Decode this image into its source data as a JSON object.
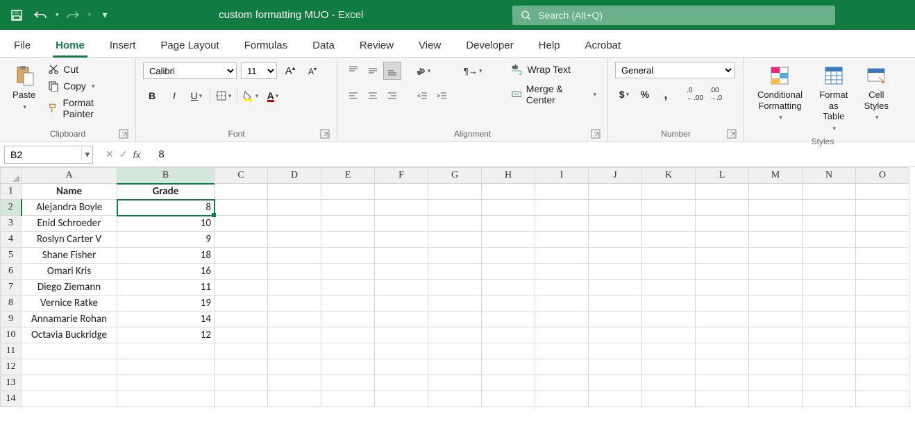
{
  "title": {
    "doc": "custom formatting MUO",
    "app": " - Excel"
  },
  "search": {
    "placeholder": "Search (Alt+Q)"
  },
  "tabs": [
    "File",
    "Home",
    "Insert",
    "Page Layout",
    "Formulas",
    "Data",
    "Review",
    "View",
    "Developer",
    "Help",
    "Acrobat"
  ],
  "active_tab": 1,
  "clipboard": {
    "paste": "Paste",
    "cut": "Cut",
    "copy": "Copy",
    "painter": "Format Painter",
    "label": "Clipboard"
  },
  "font": {
    "name": "Calibri",
    "size": "11",
    "label": "Font"
  },
  "alignment": {
    "wrap": "Wrap Text",
    "merge": "Merge & Center",
    "label": "Alignment"
  },
  "number": {
    "format": "General",
    "label": "Number"
  },
  "styles": {
    "cond": "Conditional Formatting",
    "table": "Format as Table",
    "cell": "Cell Styles",
    "label": "Styles"
  },
  "namebox": "B2",
  "formula_value": "8",
  "columns": [
    "A",
    "B",
    "C",
    "D",
    "E",
    "F",
    "G",
    "H",
    "I",
    "J",
    "K",
    "L",
    "M",
    "N",
    "O"
  ],
  "headers": {
    "A": "Name",
    "B": "Grade"
  },
  "rows": [
    {
      "n": 1,
      "A": "Name",
      "B": "Grade",
      "header": true
    },
    {
      "n": 2,
      "A": "Alejandra Boyle",
      "B": "8"
    },
    {
      "n": 3,
      "A": "Enid Schroeder",
      "B": "10"
    },
    {
      "n": 4,
      "A": "Roslyn Carter V",
      "B": "9"
    },
    {
      "n": 5,
      "A": "Shane Fisher",
      "B": "18"
    },
    {
      "n": 6,
      "A": "Omari Kris",
      "B": "16"
    },
    {
      "n": 7,
      "A": "Diego Ziemann",
      "B": "11"
    },
    {
      "n": 8,
      "A": "Vernice Ratke",
      "B": "19"
    },
    {
      "n": 9,
      "A": "Annamarie Rohan",
      "B": "14"
    },
    {
      "n": 10,
      "A": "Octavia Buckridge",
      "B": "12"
    },
    {
      "n": 11,
      "A": "",
      "B": ""
    },
    {
      "n": 12,
      "A": "",
      "B": ""
    },
    {
      "n": 13,
      "A": "",
      "B": ""
    },
    {
      "n": 14,
      "A": "",
      "B": ""
    }
  ],
  "selected": {
    "col": "B",
    "row": 2
  }
}
